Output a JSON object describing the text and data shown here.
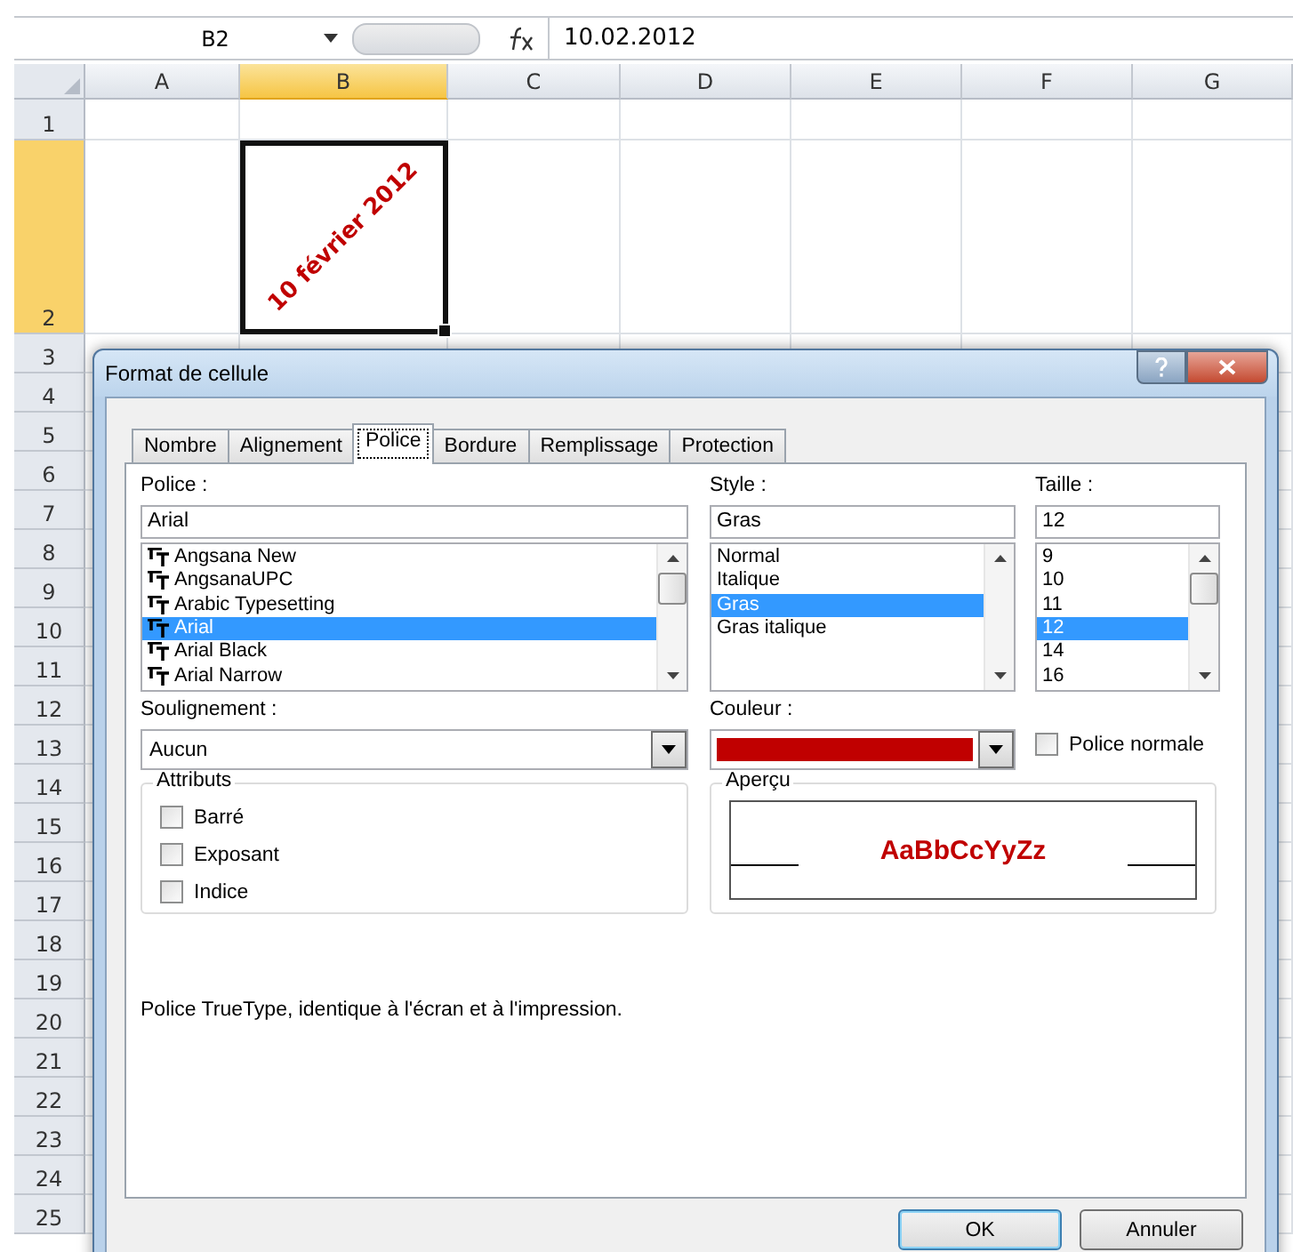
{
  "formula_bar": {
    "name_box": "B2",
    "formula": "10.02.2012"
  },
  "columns": [
    {
      "label": "A",
      "selected": false
    },
    {
      "label": "B",
      "selected": true
    },
    {
      "label": "C",
      "selected": false
    },
    {
      "label": "D",
      "selected": false
    },
    {
      "label": "E",
      "selected": false
    },
    {
      "label": "F",
      "selected": false
    },
    {
      "label": "G",
      "selected": false
    }
  ],
  "rows": [
    {
      "label": "1",
      "selected": false
    },
    {
      "label": "2",
      "selected": true
    },
    {
      "label": "3",
      "selected": false
    },
    {
      "label": "4",
      "selected": false
    },
    {
      "label": "5",
      "selected": false
    },
    {
      "label": "6",
      "selected": false
    },
    {
      "label": "7",
      "selected": false
    },
    {
      "label": "8",
      "selected": false
    },
    {
      "label": "9",
      "selected": false
    },
    {
      "label": "10",
      "selected": false
    },
    {
      "label": "11",
      "selected": false
    },
    {
      "label": "12",
      "selected": false
    },
    {
      "label": "13",
      "selected": false
    },
    {
      "label": "14",
      "selected": false
    },
    {
      "label": "15",
      "selected": false
    },
    {
      "label": "16",
      "selected": false
    },
    {
      "label": "17",
      "selected": false
    },
    {
      "label": "18",
      "selected": false
    },
    {
      "label": "19",
      "selected": false
    },
    {
      "label": "20",
      "selected": false
    },
    {
      "label": "21",
      "selected": false
    },
    {
      "label": "22",
      "selected": false
    },
    {
      "label": "23",
      "selected": false
    },
    {
      "label": "24",
      "selected": false
    },
    {
      "label": "25",
      "selected": false
    }
  ],
  "active_cell": {
    "text": "10 février 2012",
    "color": "#c00000"
  },
  "dialog": {
    "title": "Format de cellule",
    "tabs": [
      {
        "label": "Nombre",
        "selected": false
      },
      {
        "label": "Alignement",
        "selected": false
      },
      {
        "label": "Police",
        "selected": true
      },
      {
        "label": "Bordure",
        "selected": false
      },
      {
        "label": "Remplissage",
        "selected": false
      },
      {
        "label": "Protection",
        "selected": false
      }
    ],
    "police": {
      "label": "Police :",
      "value": "Arial",
      "items": [
        {
          "label": "Angsana New",
          "selected": false
        },
        {
          "label": "AngsanaUPC",
          "selected": false
        },
        {
          "label": "Arabic Typesetting",
          "selected": false
        },
        {
          "label": "Arial",
          "selected": true
        },
        {
          "label": "Arial Black",
          "selected": false
        },
        {
          "label": "Arial Narrow",
          "selected": false
        }
      ]
    },
    "style": {
      "label": "Style :",
      "value": "Gras",
      "items": [
        {
          "label": "Normal",
          "selected": false
        },
        {
          "label": "Italique",
          "selected": false
        },
        {
          "label": "Gras",
          "selected": true
        },
        {
          "label": "Gras italique",
          "selected": false
        }
      ]
    },
    "taille": {
      "label": "Taille :",
      "value": "12",
      "items": [
        {
          "label": "9",
          "selected": false
        },
        {
          "label": "10",
          "selected": false
        },
        {
          "label": "11",
          "selected": false
        },
        {
          "label": "12",
          "selected": true
        },
        {
          "label": "14",
          "selected": false
        },
        {
          "label": "16",
          "selected": false
        }
      ]
    },
    "soulignement": {
      "label": "Soulignement :",
      "value": "Aucun"
    },
    "couleur": {
      "label": "Couleur :",
      "color": "#c00000"
    },
    "police_normale": {
      "label": "Police normale",
      "checked": false
    },
    "attributs": {
      "title": "Attributs",
      "items": [
        {
          "label": "Barré",
          "checked": false
        },
        {
          "label": "Exposant",
          "checked": false
        },
        {
          "label": "Indice",
          "checked": false
        }
      ]
    },
    "apercu": {
      "title": "Aperçu",
      "sample": "AaBbCcYyZz"
    },
    "description": "Police TrueType, identique à l'écran et à l'impression.",
    "buttons": [
      {
        "label": "OK",
        "kind": "default"
      },
      {
        "label": "Annuler",
        "kind": "normal"
      }
    ]
  }
}
